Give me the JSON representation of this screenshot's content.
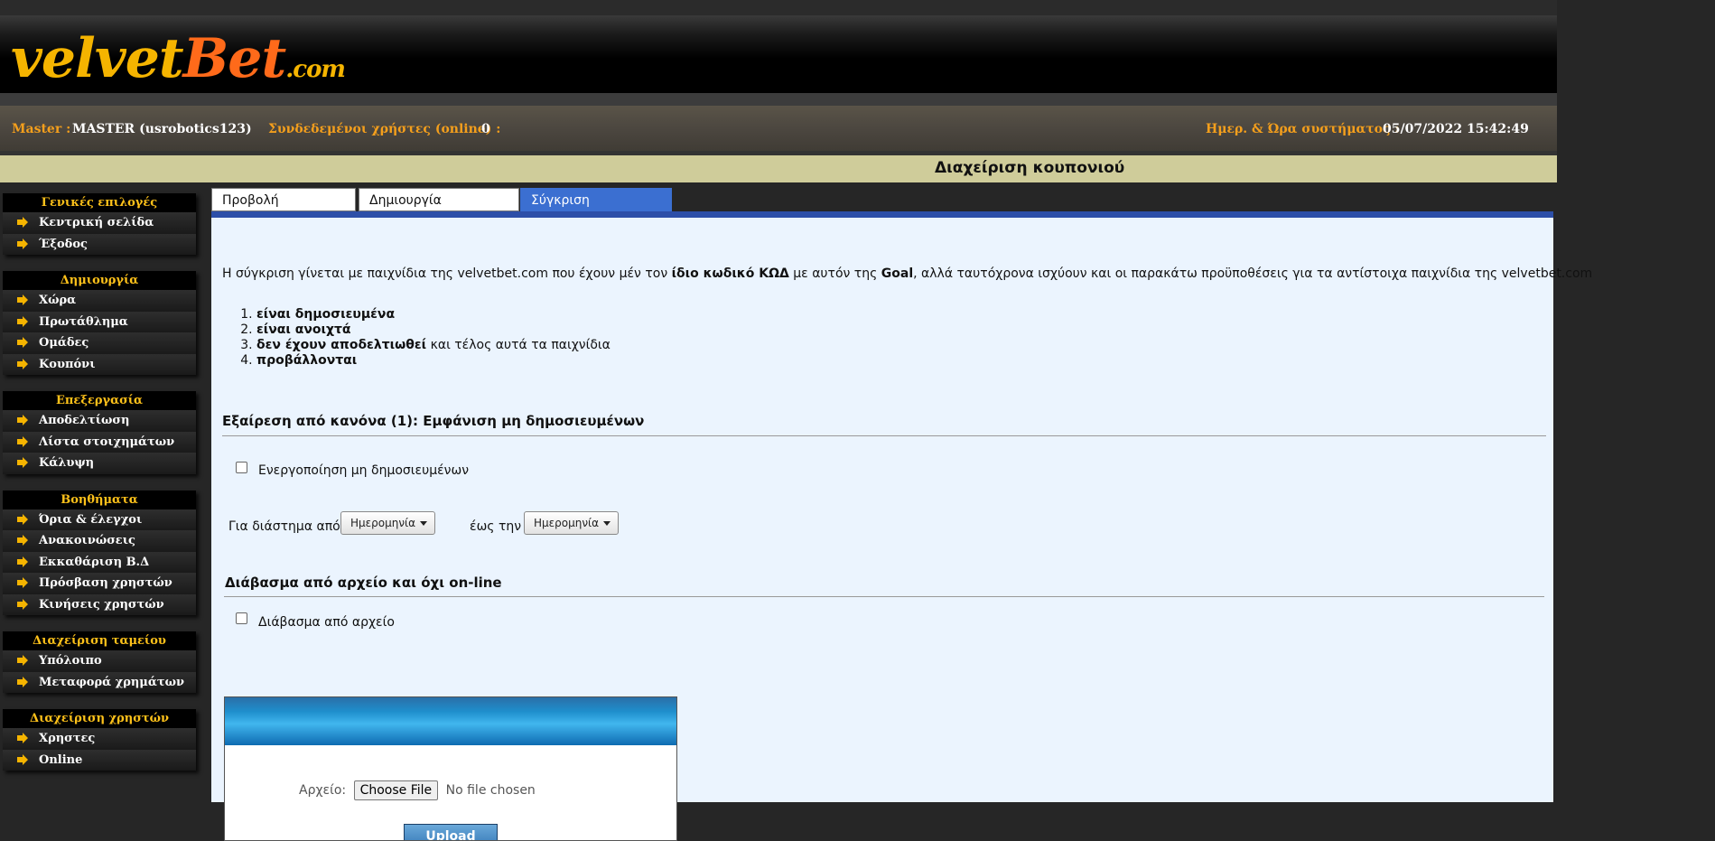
{
  "logo": {
    "part1": "velvet",
    "part2": "Bet",
    "part3": ".com"
  },
  "info": {
    "master_label": "Master :",
    "master_value": "MASTER (usrobotics123)",
    "online_label": "Συνδεδεμένοι χρήστες (online) :",
    "online_value": "0",
    "datetime_label": "Ημερ. & Ώρα συστήματος :",
    "datetime_value": "05/07/2022 15:42:49"
  },
  "page_title": "Διαχείριση κουπονιού",
  "sidebar": [
    {
      "title": "Γενικές επιλογές",
      "items": [
        "Κεντρική σελίδα",
        "Έξοδος"
      ]
    },
    {
      "title": "Δημιουργία",
      "items": [
        "Χώρα",
        "Πρωτάθλημα",
        "Ομάδες",
        "Κουπόνι"
      ]
    },
    {
      "title": "Επεξεργασία",
      "items": [
        "Αποδελτίωση",
        "Λίστα στοιχημάτων",
        "Κάλυψη"
      ]
    },
    {
      "title": "Βοηθήματα",
      "items": [
        "Όρια & έλεγχοι",
        "Ανακοινώσεις",
        "Εκκαθάριση Β.Δ",
        "Πρόσβαση χρηστών",
        "Κινήσεις χρηστών"
      ]
    },
    {
      "title": "Διαχείριση ταμείου",
      "items": [
        "Υπόλοιπο",
        "Μεταφορά χρημάτων"
      ]
    },
    {
      "title": "Διαχείριση χρηστών",
      "items": [
        "Χρηστες",
        "Online"
      ]
    }
  ],
  "tabs": [
    "Προβολή κουπονιού",
    "Δημιουργία κουπονιού",
    "Σύγκριση αποδόσεων"
  ],
  "active_tab": 2,
  "intro": {
    "t1": "Η σύγκριση γίνεται με παιχνίδια της velvetbet.com που έχουν μέν τον ",
    "b1": "ίδιο κωδικό ΚΩΔ",
    "t2": " με αυτόν της ",
    "b2": "Goal",
    "t3": ", αλλά ταυτόχρονα ισχύουν και οι παρακάτω προϋποθέσεις για τα αντίστοιχα παιχνίδια της velvetbet.com"
  },
  "rules": [
    {
      "bold": "είναι δημοσιευμένα",
      "rest": ""
    },
    {
      "bold": "είναι ανοιχτά",
      "rest": ""
    },
    {
      "bold": "δεν έχουν αποδελτιωθεί",
      "rest": " και τέλος αυτά τα παιχνίδια"
    },
    {
      "bold": "προβάλλονται",
      "rest": ""
    }
  ],
  "exception": {
    "heading": "Εξαίρεση από κανόνα (1): Εμφάνιση μη δημοσιευμένων",
    "checkbox_label": "Ενεργοποίηση μη δημοσιευμένων",
    "from_label": "Για διάστημα από",
    "from_button": "Ημερομηνία",
    "to_label": "έως την",
    "to_button": "Ημερομηνία"
  },
  "file_section": {
    "heading": "Διάβασμα από αρχείο και όχι on-line",
    "checkbox_label": "Διάβασμα από αρχείο",
    "file_label": "Αρχείο:",
    "choose_button": "Choose File",
    "no_file": "No file chosen",
    "upload_button": "Upload"
  },
  "colors": {
    "accent_orange": "#f49f1c",
    "menu_yellow": "#ffc21a",
    "tab_active": "#3b6fd1",
    "panel_bg": "#ebf4fe",
    "title_bar": "#cfcc9a"
  }
}
